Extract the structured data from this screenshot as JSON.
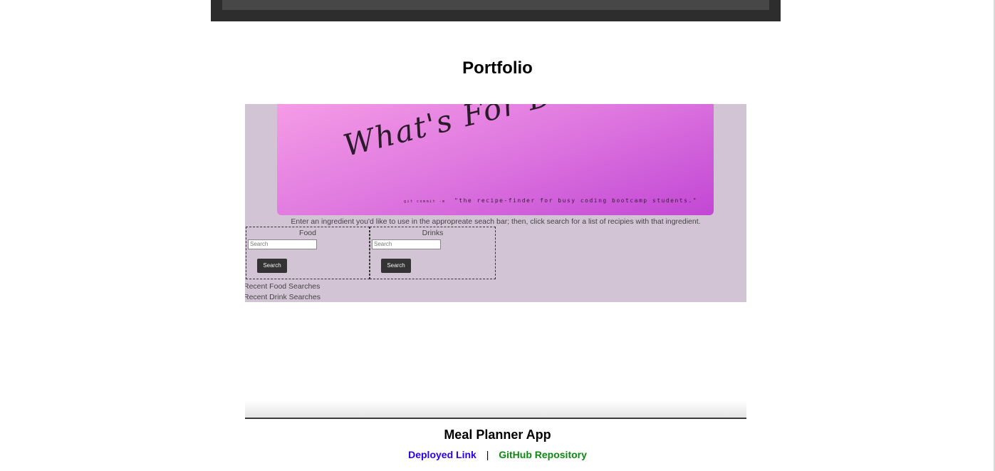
{
  "portfolio": {
    "title": "Portfolio"
  },
  "project": {
    "screenshot": {
      "banner_title": "What's For Dinner?",
      "banner_commit": "git commit -m",
      "banner_tagline": "\"the recipe-finder for busy coding bootcamp students.\"",
      "instructions": "Enter an ingredient you'd like to use in the appropreate seach bar; then, click search for a list of recipies with that ingredient.",
      "food_label": "Food",
      "drinks_label": "Drinks",
      "search_placeholder": "Search",
      "search_button": "Search",
      "recent_food": "Recent Food Searches",
      "recent_drink": "Recent Drink Searches",
      "colors": {
        "banner_start": "#f59be6",
        "banner_end": "#c247d4",
        "app_background": "#d3c4d5"
      }
    },
    "name": "Meal Planner App",
    "links": {
      "deployed_label": "Deployed Link",
      "separator": "|",
      "github_label": "GitHub Repository"
    }
  }
}
